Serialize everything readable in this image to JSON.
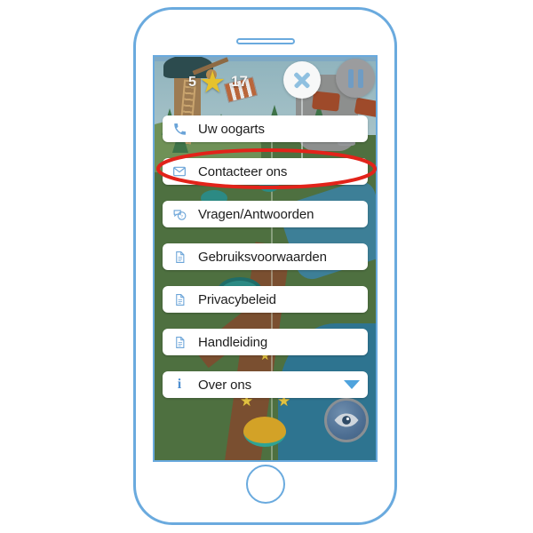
{
  "device": {
    "name": "smartphone-mockup",
    "frame_color": "#6aaade",
    "body_color": "#ffffff"
  },
  "game_hud": {
    "score": "5",
    "star_icon": "star-icon",
    "collectible_count": "17",
    "ticket_icon": "ticket-icon",
    "close_label": "✕",
    "close_icon": "close-icon",
    "pause_icon": "pause-icon",
    "eye_icon": "eye-icon"
  },
  "menu": {
    "items": [
      {
        "label": "Uw oogarts",
        "icon": "phone-icon",
        "icon_glyph": "✆",
        "has_caret": false
      },
      {
        "label": "Contacteer ons",
        "icon": "envelope-icon",
        "icon_glyph": "✉",
        "has_caret": false
      },
      {
        "label": "Vragen/Antwoorden",
        "icon": "question-bubble-icon",
        "icon_glyph": "❓",
        "has_caret": false
      },
      {
        "label": "Gebruiksvoorwaarden",
        "icon": "document-icon",
        "icon_glyph": "☰",
        "has_caret": false
      },
      {
        "label": "Privacybeleid",
        "icon": "document-icon",
        "icon_glyph": "☰",
        "has_caret": false
      },
      {
        "label": "Handleiding",
        "icon": "document-icon",
        "icon_glyph": "☰",
        "has_caret": false
      },
      {
        "label": "Over ons",
        "icon": "info-icon",
        "icon_glyph": "i",
        "has_caret": true
      }
    ]
  },
  "annotation": {
    "type": "ellipse-highlight",
    "color": "#e2231a",
    "targets": "Contacteer ons"
  },
  "colors": {
    "accent_blue": "#6aaade",
    "icon_blue": "#6ba4d8",
    "field_green": "#4e7040",
    "water_blue": "#2e7490",
    "path_brown": "#7a4f30",
    "annotation_red": "#e2231a"
  }
}
